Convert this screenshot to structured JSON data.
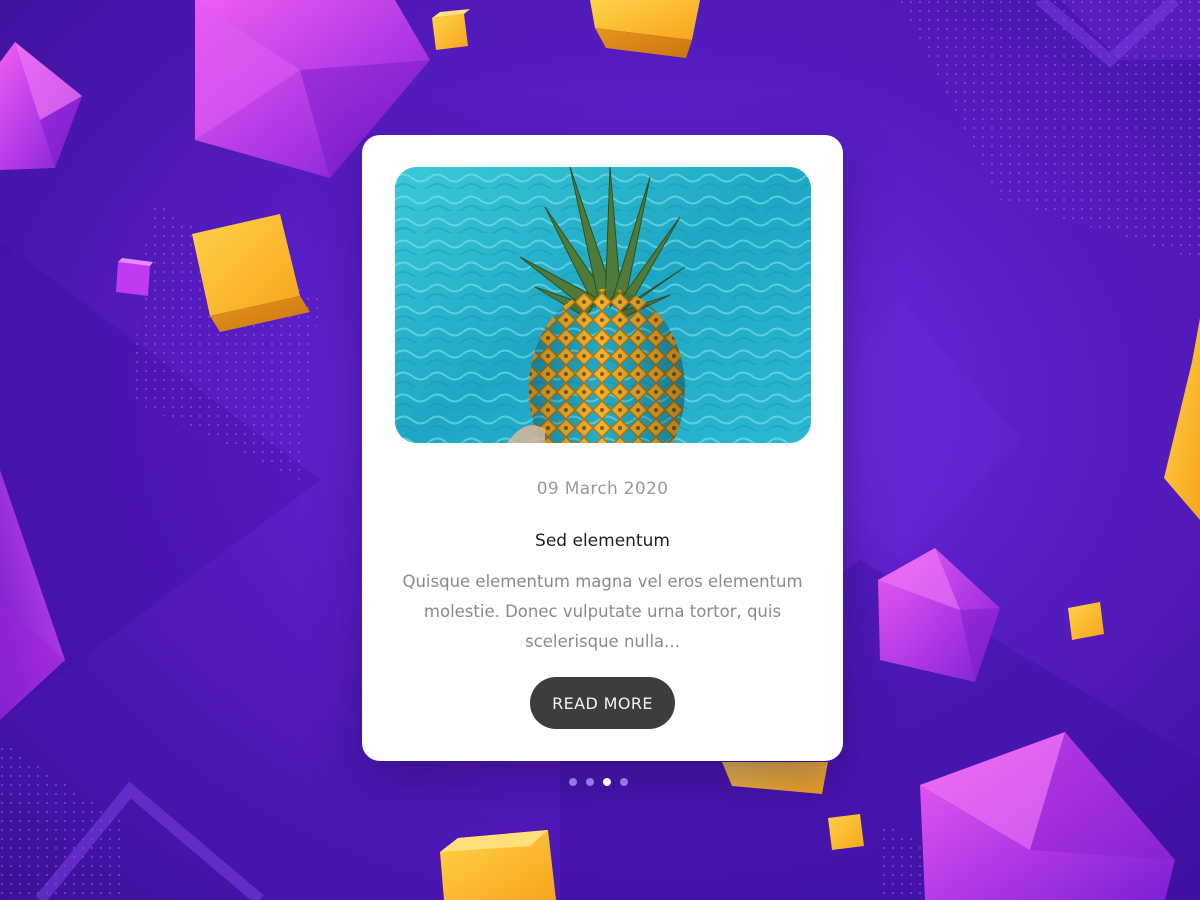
{
  "card": {
    "image_alt": "Pineapple held above pool water",
    "date": "09 March 2020",
    "title": "Sed elementum",
    "excerpt": "Quisque elementum magna vel eros elementum molestie. Donec vulputate urna tortor, quis scelerisque nulla...",
    "button_label": "READ MORE"
  },
  "pagination": {
    "count": 4,
    "active_index": 2
  },
  "colors": {
    "background_primary": "#5a1fc8",
    "accent_purple": "#c23af0",
    "accent_yellow": "#f7b52a",
    "button": "#3d3d3d",
    "water": "#2ab6cf"
  }
}
